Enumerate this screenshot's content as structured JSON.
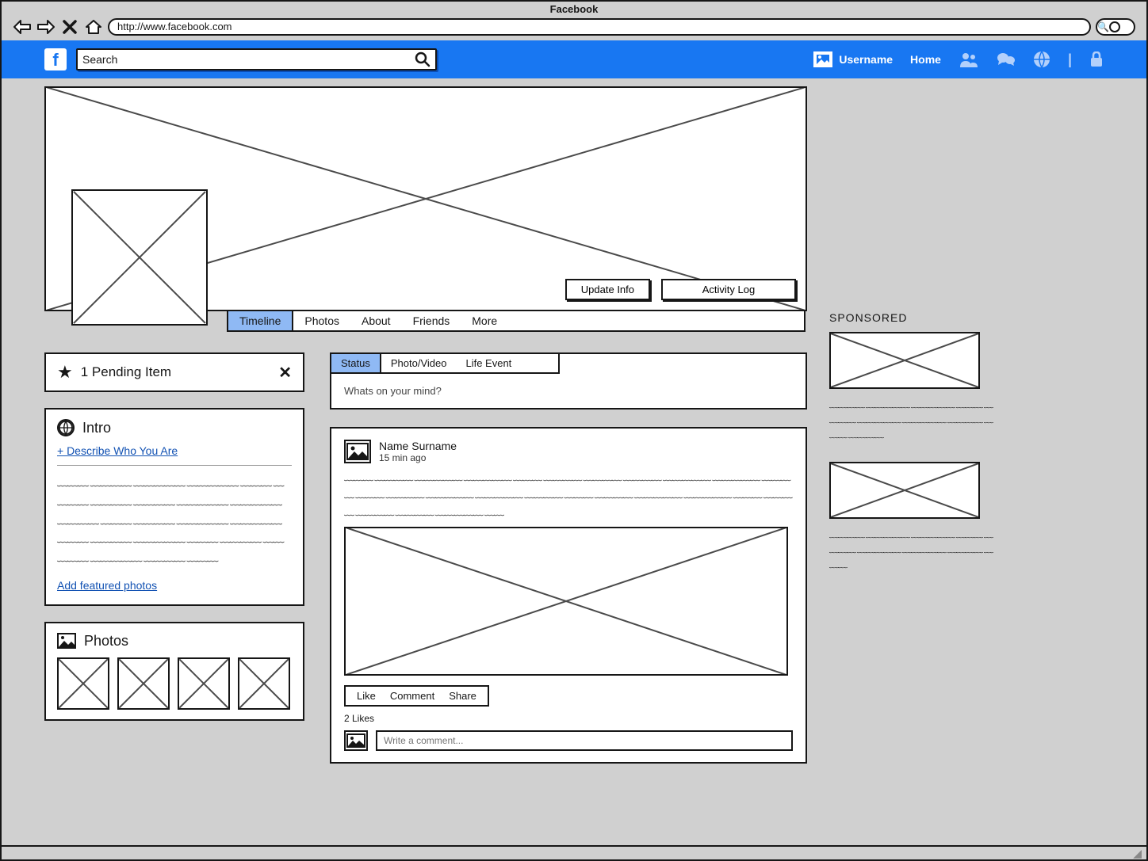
{
  "browser": {
    "title": "Facebook",
    "url": "http://www.facebook.com"
  },
  "header": {
    "search_placeholder": "Search",
    "username": "Username",
    "home_label": "Home"
  },
  "cover": {
    "update_info_label": "Update Info",
    "activity_log_label": "Activity Log"
  },
  "profile_tabs": {
    "items": [
      "Timeline",
      "Photos",
      "About",
      "Friends",
      "More"
    ],
    "active_index": 0
  },
  "pending": {
    "label": "1 Pending Item"
  },
  "intro": {
    "title": "Intro",
    "describe_link": "+  Describe Who You Are",
    "add_photos_link": "Add featured photos"
  },
  "photos_panel": {
    "title": "Photos"
  },
  "composer": {
    "tabs": [
      "Status",
      "Photo/Video",
      "Life Event"
    ],
    "active_index": 0,
    "placeholder": "Whats on your mind?"
  },
  "post": {
    "author": "Name Surname",
    "time": "15 min ago",
    "actions": {
      "like": "Like",
      "comment": "Comment",
      "share": "Share"
    },
    "likes": "2 Likes",
    "comment_placeholder": "Write a comment..."
  },
  "sponsored": {
    "title": "SPONSORED"
  }
}
